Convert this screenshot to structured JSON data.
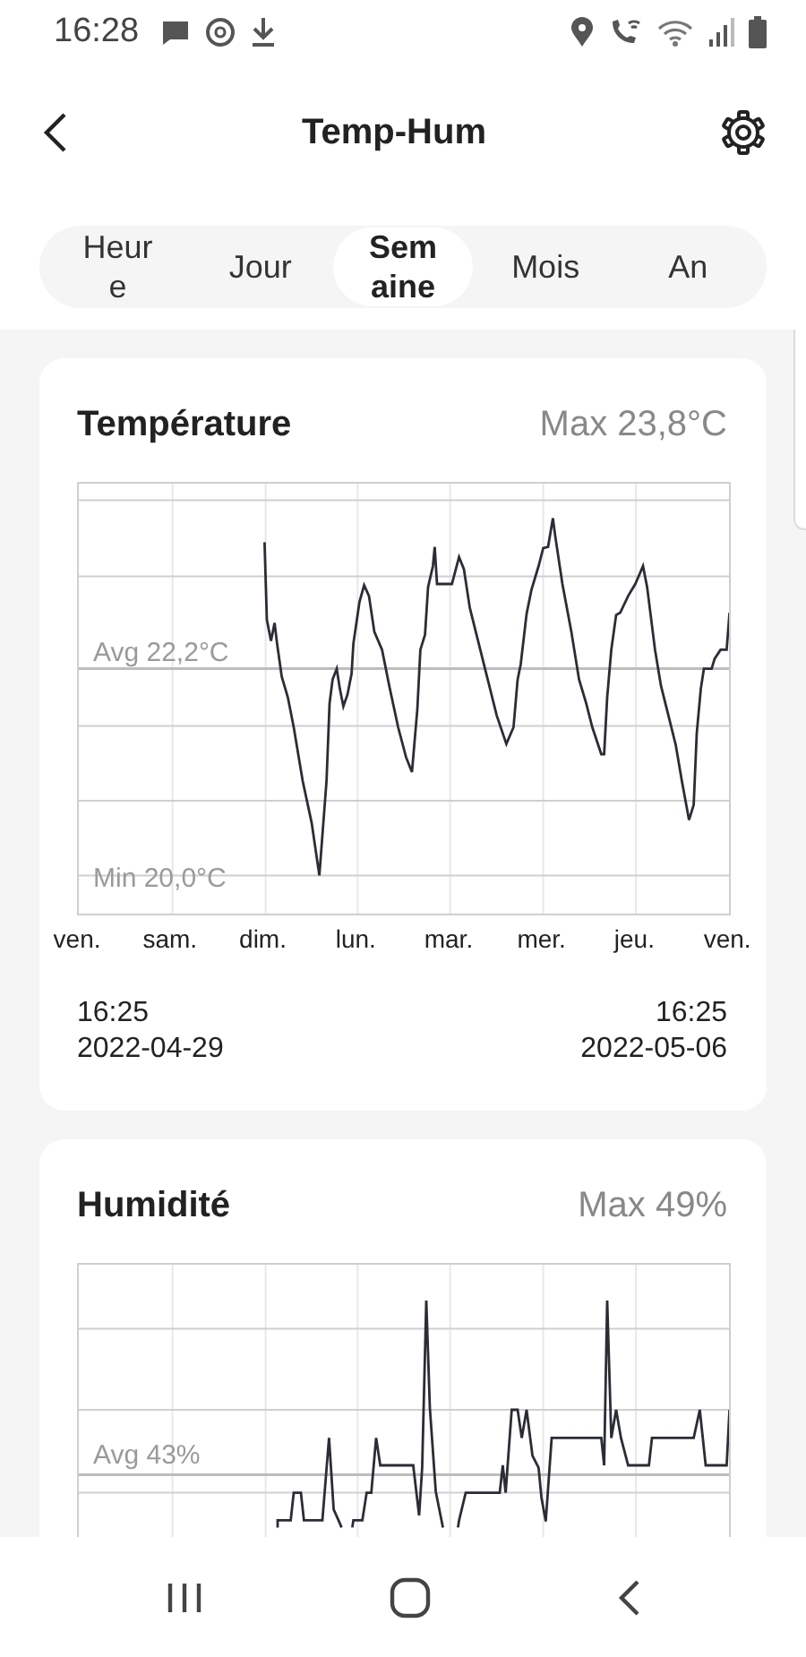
{
  "status_bar": {
    "time": "16:28"
  },
  "header": {
    "title": "Temp-Hum"
  },
  "tabs": [
    {
      "label": "Heure",
      "selected": false
    },
    {
      "label": "Jour",
      "selected": false
    },
    {
      "label": "Semaine",
      "selected": true
    },
    {
      "label": "Mois",
      "selected": false
    },
    {
      "label": "An",
      "selected": false
    }
  ],
  "cards": [
    {
      "kind": "temperature",
      "title": "Température",
      "max": "Max 23,8°C",
      "avg": "Avg 22,2°C",
      "min": "Min 20,0°C",
      "days": [
        "ven.",
        "sam.",
        "dim.",
        "lun.",
        "mar.",
        "mer.",
        "jeu.",
        "ven."
      ],
      "start_time": "16:25",
      "start_date": "2022-04-29",
      "end_time": "16:25",
      "end_date": "2022-05-06"
    },
    {
      "kind": "humidity",
      "title": "Humidité",
      "max": "Max 49%",
      "avg": "Avg 43%"
    }
  ]
}
